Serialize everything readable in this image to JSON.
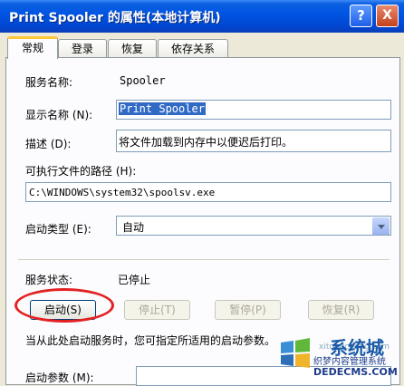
{
  "window": {
    "title": "Print Spooler 的属性(本地计算机)",
    "help_glyph": "?",
    "close_glyph": "X"
  },
  "tabs": [
    {
      "label": "常规"
    },
    {
      "label": "登录"
    },
    {
      "label": "恢复"
    },
    {
      "label": "依存关系"
    }
  ],
  "general": {
    "service_name_label": "服务名称:",
    "service_name_value": "Spooler",
    "display_name_label": "显示名称 (N):",
    "display_name_value": "Print Spooler",
    "description_label": "描述 (D):",
    "description_value": "将文件加载到内存中以便迟后打印。",
    "exe_path_label": "可执行文件的路径 (H):",
    "exe_path_value": "C:\\WINDOWS\\system32\\spoolsv.exe",
    "startup_type_label": "启动类型 (E):",
    "startup_type_value": "自动",
    "status_label": "服务状态:",
    "status_value": "已停止",
    "hint_text": "当从此处启动服务时，您可指定所适用的启动参数。",
    "params_label": "启动参数 (M):"
  },
  "buttons": {
    "start": "启动(S)",
    "stop": "停止(T)",
    "pause": "暂停(P)",
    "resume": "恢复(R)"
  },
  "watermark": {
    "brand": "系统城",
    "site": "织梦内容管理系统",
    "url": "DEDECMS.COM",
    "faint": "xitongcheng.com"
  }
}
